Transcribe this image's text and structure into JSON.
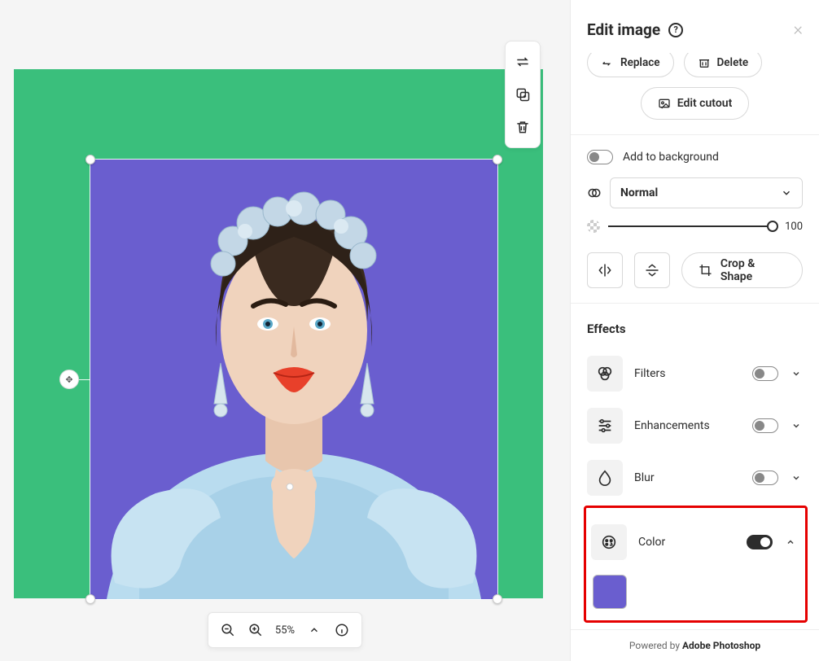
{
  "panel": {
    "title": "Edit image",
    "replace_label": "Replace",
    "delete_label": "Delete",
    "edit_cutout_label": "Edit cutout",
    "add_to_background_label": "Add to background",
    "blend_mode_label": "Normal",
    "opacity_value": "100",
    "crop_label": "Crop & Shape",
    "effects_title": "Effects",
    "effects": {
      "filters": {
        "label": "Filters",
        "on": false
      },
      "enhancements": {
        "label": "Enhancements",
        "on": false
      },
      "blur": {
        "label": "Blur",
        "on": false
      },
      "color": {
        "label": "Color",
        "on": true
      }
    },
    "color_swatch": "#6a5ecf"
  },
  "zoom": {
    "level": "55%"
  },
  "footer": {
    "prefix": "Powered by ",
    "brand": "Adobe Photoshop"
  },
  "canvas": {
    "bg": "#3ABF7C",
    "cutout_bg": "#6a5ecf"
  }
}
